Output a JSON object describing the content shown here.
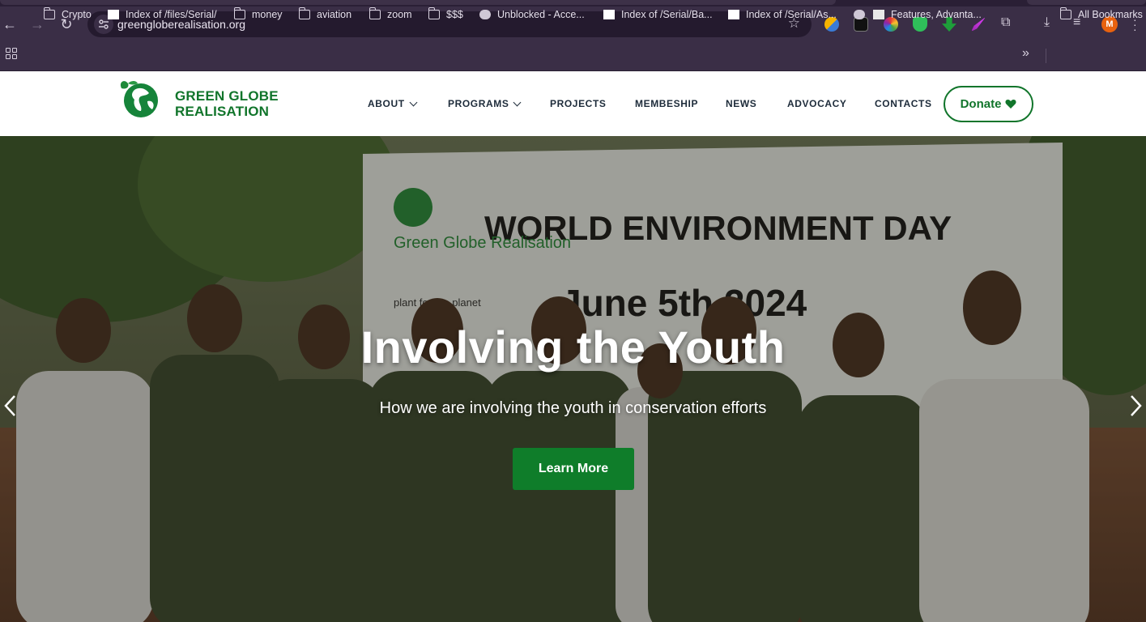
{
  "browser": {
    "url": "greenglobere alisation.org",
    "bookmarks": [
      {
        "label": "Crypto",
        "icon": "folder-icon"
      },
      {
        "label": "Index of /files/Serial/",
        "icon": "page-icon"
      },
      {
        "label": "money",
        "icon": "folder-icon"
      },
      {
        "label": "aviation",
        "icon": "folder-icon"
      },
      {
        "label": "zoom",
        "icon": "folder-icon"
      },
      {
        "label": "$$$",
        "icon": "folder-icon"
      },
      {
        "label": "Unblocked - Acce...",
        "icon": "globe-icon"
      },
      {
        "label": "Index of /Serial/Ba...",
        "icon": "page-icon"
      },
      {
        "label": "Index of /Serial/As...",
        "icon": "page-icon"
      },
      {
        "label": "Features, Advanta...",
        "icon": "site-icon"
      }
    ],
    "all_bookmarks": "All Bookmarks",
    "profile_initial": "M"
  },
  "site": {
    "logo_line1": "GREEN GLOBE",
    "logo_line2": "REALISATION",
    "nav": [
      {
        "label": "ABOUT",
        "dropdown": true
      },
      {
        "label": "PROGRAMS",
        "dropdown": true
      },
      {
        "label": "PROJECTS",
        "dropdown": false
      },
      {
        "label": "MEMBESHIP",
        "dropdown": false
      },
      {
        "label": "NEWS",
        "dropdown": false
      },
      {
        "label": "ADVOCACY",
        "dropdown": false
      },
      {
        "label": "CONTACTS",
        "dropdown": false
      }
    ],
    "donate_label": "Donate",
    "brand_color": "#11752b"
  },
  "hero": {
    "title": "Involving the Youth",
    "subtitle": "How we are involving the youth in conservation efforts",
    "button_label": "Learn More",
    "banner_heading": "WORLD ENVIRONMENT DAY",
    "banner_date": "June 5th 2024",
    "banner_brand": "Green Globe Realisation",
    "banner_tagline": "plant for the planet",
    "button_color": "#0f7d2a"
  }
}
